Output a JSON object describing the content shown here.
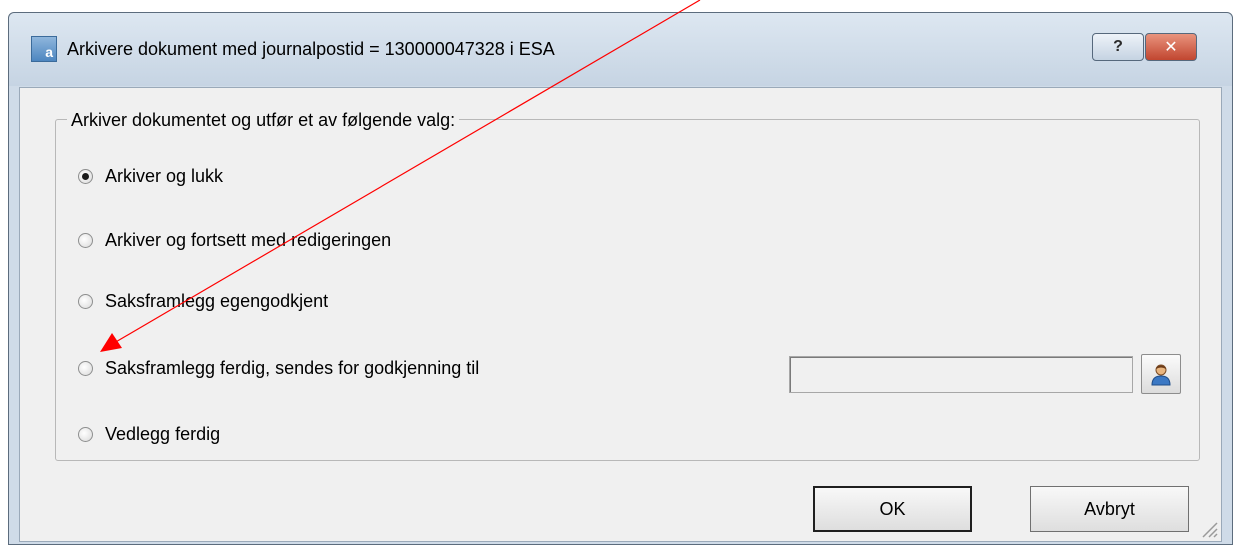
{
  "window": {
    "title": "Arkivere dokument med journalpostid = 130000047328 i ESA",
    "help_label": "?",
    "close_label": "✕"
  },
  "group": {
    "legend": "Arkiver dokumentet og utfør et av følgende valg:"
  },
  "options": [
    {
      "label": "Arkiver og lukk",
      "checked": true
    },
    {
      "label": "Arkiver og fortsett med redigeringen",
      "checked": false
    },
    {
      "label": "Saksframlegg egengodkjent",
      "checked": false
    },
    {
      "label": "Saksframlegg ferdig, sendes for godkjenning til",
      "checked": false
    },
    {
      "label": "Vedlegg ferdig",
      "checked": false
    }
  ],
  "approver": {
    "value": "",
    "button_icon": "person-icon"
  },
  "buttons": {
    "ok": "OK",
    "cancel": "Avbryt"
  },
  "annotation": {
    "arrow_color": "#ff0000",
    "points_to": "Saksframlegg ferdig, sendes for godkjenning til"
  },
  "colors": {
    "title_bar": "#cfdbe8",
    "client_bg": "#f0f0f0",
    "close_button": "#c14630"
  }
}
